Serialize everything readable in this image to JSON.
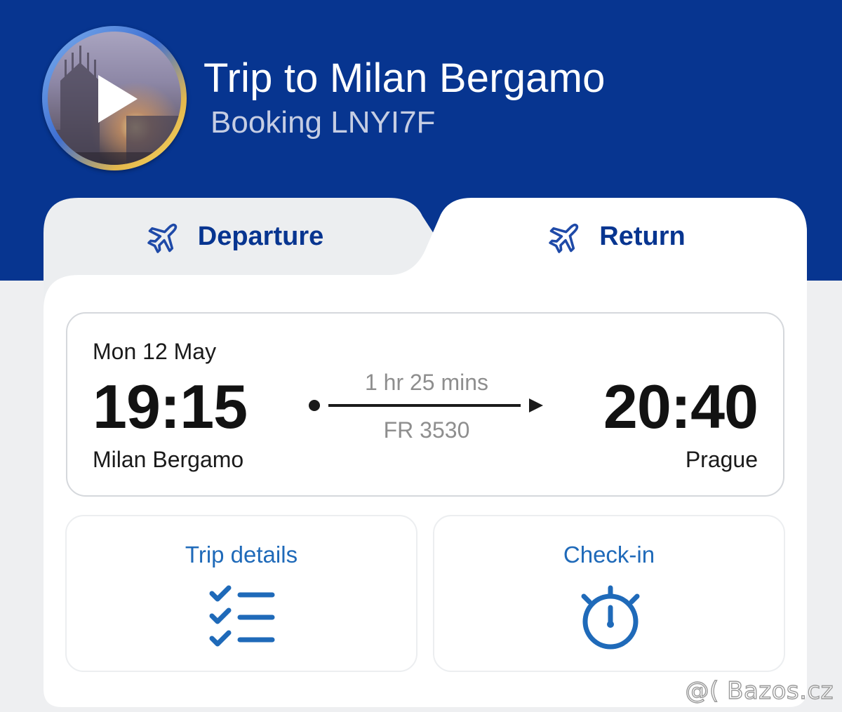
{
  "header": {
    "title": "Trip to Milan Bergamo",
    "booking_label": "Booking",
    "booking_ref": "LNYI7F",
    "thumbnail_icon": "play-icon"
  },
  "tabs": [
    {
      "label": "Departure",
      "icon": "plane-icon",
      "selected": false
    },
    {
      "label": "Return",
      "icon": "plane-icon",
      "selected": true
    }
  ],
  "flight": {
    "date": "Mon 12 May",
    "departure_time": "19:15",
    "arrival_time": "20:40",
    "origin": "Milan Bergamo",
    "destination": "Prague",
    "duration": "1 hr 25 mins",
    "flight_number": "FR 3530"
  },
  "actions": [
    {
      "label": "Trip details",
      "icon": "checklist-icon"
    },
    {
      "label": "Check-in",
      "icon": "stopwatch-icon"
    }
  ],
  "watermark": "@( Bazos.cz",
  "colors": {
    "brand_blue": "#073590",
    "link_blue": "#1f6ab9",
    "muted_text": "#8e8e8e"
  }
}
